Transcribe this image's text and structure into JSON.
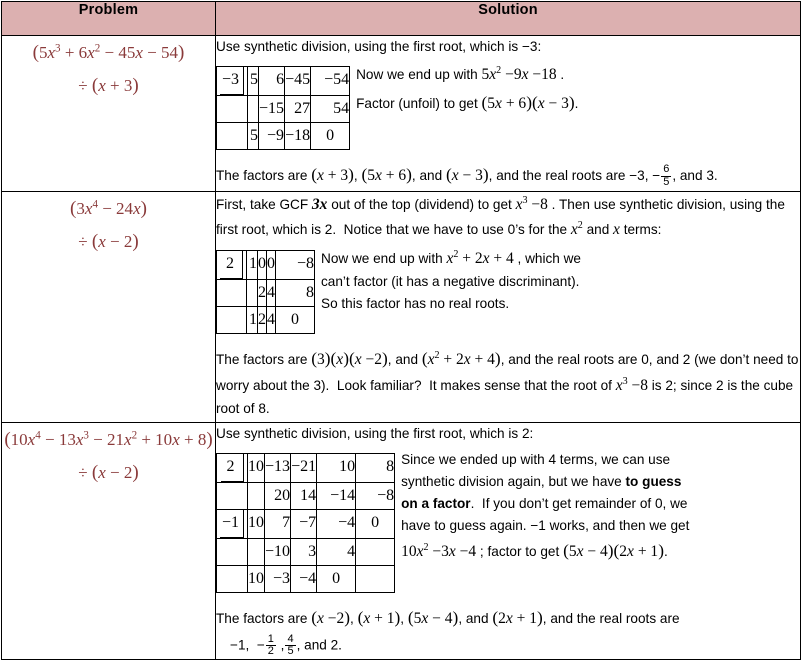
{
  "table": {
    "headers": [
      "Problem",
      "Solution"
    ],
    "accent_header_bg": "#dcb0b0",
    "problem_text_color": "#8a3a3a",
    "rows": [
      {
        "problem": {
          "line1": "(5x³ + 6x² − 45x − 54)",
          "line2": "÷ (x + 3)"
        },
        "intro": "Use synthetic division, using the first root, which is −3:",
        "synthetic": {
          "divisor": "−3",
          "row_top": [
            "5",
            "6",
            "−45",
            "−54"
          ],
          "row_mid": [
            "−15",
            "27",
            "54"
          ],
          "row_bottom": [
            "5",
            "−9",
            "−18"
          ],
          "remainder": "0"
        },
        "side_notes": [
          "Now we end up with 5x² −9x −18 .",
          "Factor (unfoil) to get (5x + 6)(x − 3)."
        ],
        "conclusion": "The factors are (x + 3), (5x + 6), and (x − 3), and the real roots are −3, − 6/5, and 3."
      },
      {
        "problem": {
          "line1": "(3x⁴ − 24x)",
          "line2": "÷ (x − 2)"
        },
        "intro": "First, take GCF 3x out of the top (dividend) to get x³ −8 . Then use synthetic division, using the first root, which is 2.  Notice that we have to use 0’s for the x² and x terms:",
        "intro_bold_term": "3x",
        "synthetic": {
          "divisor": "2",
          "row_top": [
            "1",
            "0",
            "0",
            "−8"
          ],
          "row_mid": [
            "2",
            "4",
            "8"
          ],
          "row_bottom": [
            "1",
            "2",
            "4"
          ],
          "remainder": "0"
        },
        "side_notes": [
          "Now we end up with x² + 2x + 4 , which we",
          "can’t factor (it has a negative discriminant).",
          "So this factor has no real roots."
        ],
        "conclusion": "The factors are (3)(x)(x −2), and (x² + 2x + 4), and the real roots are 0, and 2 (we don’t need to worry about the 3).  Look familiar?  It makes sense that the root of x³ −8 is 2; since 2 is the cube root of 8."
      },
      {
        "problem": {
          "line1": "(10x⁴ − 13x³ − 21x² + 10x + 8)",
          "line2": "÷ (x − 2)"
        },
        "intro": "Use synthetic division, using the first root, which is 2:",
        "synthetic": {
          "divisor": "2",
          "row_top": [
            "10",
            "−13",
            "−21",
            "10",
            "8"
          ],
          "row_mid": [
            "20",
            "14",
            "−14",
            "−8"
          ],
          "divisor2": "−1",
          "row_bottom": [
            "10",
            "7",
            "−7",
            "−4"
          ],
          "remainder": "0",
          "row_mid2": [
            "−10",
            "3",
            "4"
          ],
          "row_bottom2": [
            "10",
            "−3",
            "−4"
          ],
          "remainder2": "0"
        },
        "side_notes": [
          "Since we ended up with 4 terms, we can use",
          "synthetic division again, but we have to guess",
          "on a factor.  If you don’t get remainder of 0, we",
          "have to guess again. −1 works, and then we get",
          "10x² −3x −4 ; factor to get (5x − 4)(2x + 1)."
        ],
        "side_notes_bold": "to guess on a factor",
        "conclusion": "The factors are (x −2), (x + 1), (5x − 4), and (2x + 1), and the real roots are −1, − 1/2 , 4/5 , and 2."
      }
    ]
  }
}
